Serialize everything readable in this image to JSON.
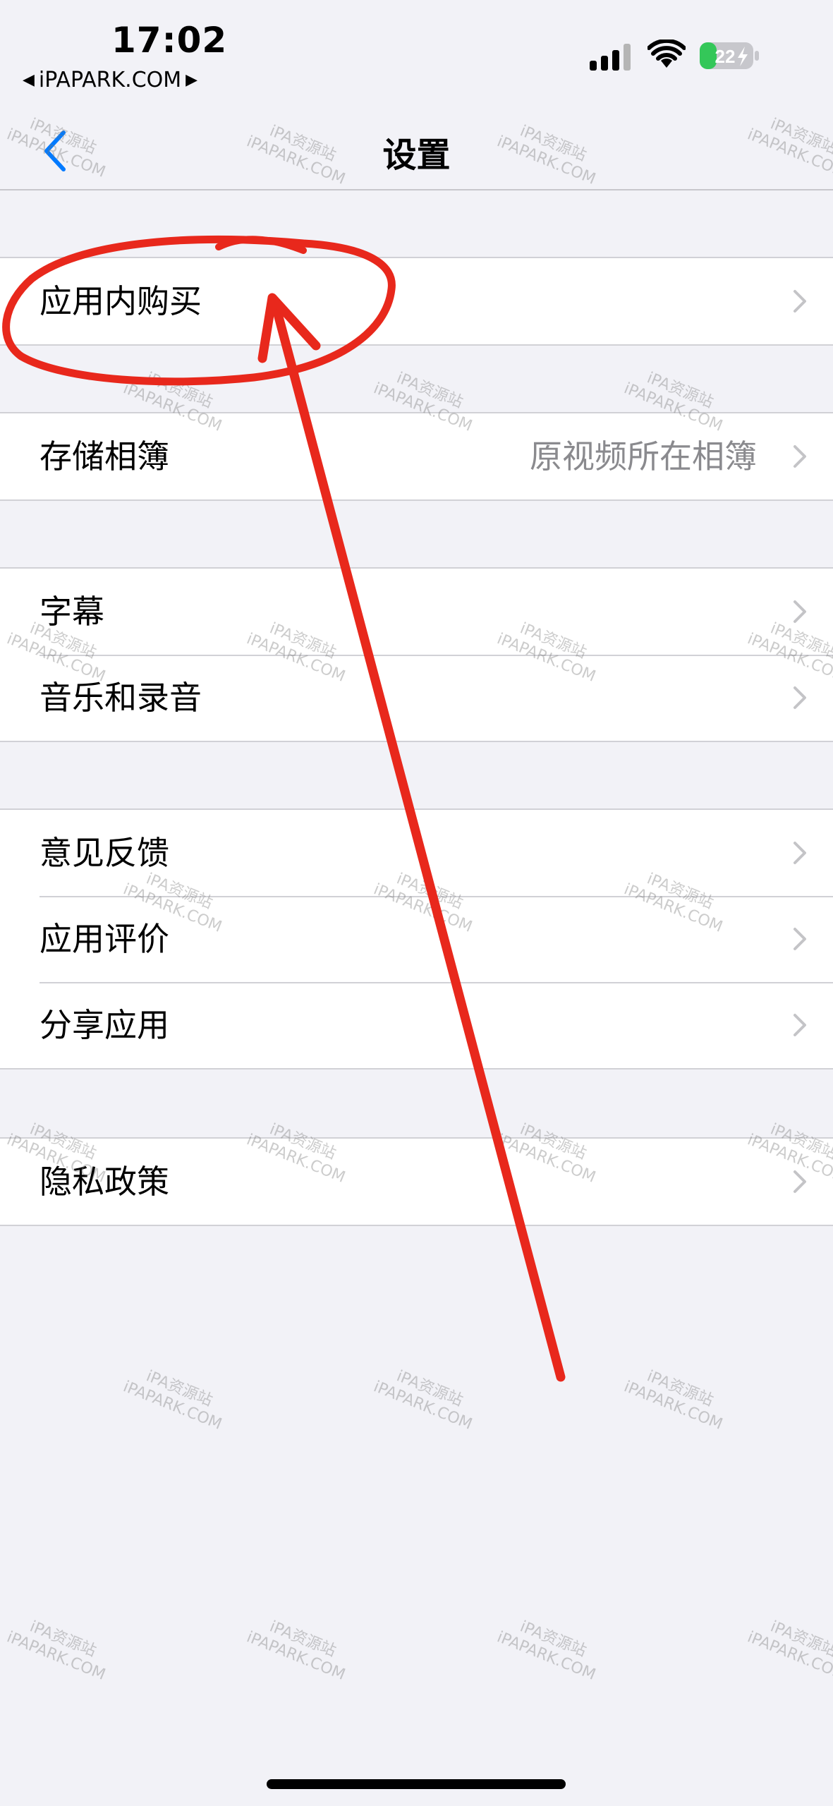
{
  "status_bar": {
    "time": "17:02",
    "back_app": "iPAPARK.COM",
    "battery_level": "22"
  },
  "nav": {
    "title": "设置",
    "back_icon": "chevron-left-icon"
  },
  "groups": [
    {
      "rows": [
        {
          "label": "应用内购买",
          "value": ""
        }
      ]
    },
    {
      "rows": [
        {
          "label": "存储相簿",
          "value": "原视频所在相簿"
        }
      ]
    },
    {
      "rows": [
        {
          "label": "字幕",
          "value": ""
        },
        {
          "label": "音乐和录音",
          "value": ""
        }
      ]
    },
    {
      "rows": [
        {
          "label": "意见反馈",
          "value": ""
        },
        {
          "label": "应用评价",
          "value": ""
        },
        {
          "label": "分享应用",
          "value": ""
        }
      ]
    },
    {
      "rows": [
        {
          "label": "隐私政策",
          "value": ""
        }
      ]
    }
  ],
  "watermark": {
    "line1": "iPA资源站",
    "line2": "iPAPARK.COM"
  },
  "colors": {
    "background": "#f2f2f7",
    "accent": "#007aff",
    "annotation": "#e8281c",
    "battery": "#34c759"
  }
}
